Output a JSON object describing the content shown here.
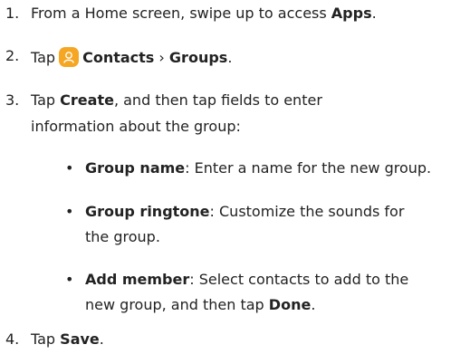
{
  "steps": [
    {
      "number": "1.",
      "text_before": "From a Home screen, swipe up to access ",
      "bold": "Apps",
      "text_after": "."
    },
    {
      "number": "2.",
      "tap": "Tap",
      "contacts": "Contacts",
      "separator": "›",
      "groups": "Groups",
      "period": ".",
      "icon": "contacts-icon"
    },
    {
      "number": "3.",
      "tap": "Tap ",
      "create": "Create",
      "line1_rest": ", and then tap fields to enter",
      "line2": "information about the group:",
      "bullets": [
        {
          "marker": "•",
          "label": "Group name",
          "text": ": Enter a name for the new group."
        },
        {
          "marker": "•",
          "label": "Group ringtone",
          "text": ": Customize the sounds for",
          "text_line2": "the group."
        },
        {
          "marker": "•",
          "label": "Add member",
          "text": ": Select contacts to add to the",
          "text_line2_before": "new group, and then tap ",
          "text_line2_bold": "Done",
          "text_line2_after": "."
        }
      ]
    },
    {
      "number": "4.",
      "tap": "Tap ",
      "bold": "Save",
      "period": "."
    }
  ],
  "colors": {
    "text": "#222222",
    "icon_background": "#f5a623"
  }
}
